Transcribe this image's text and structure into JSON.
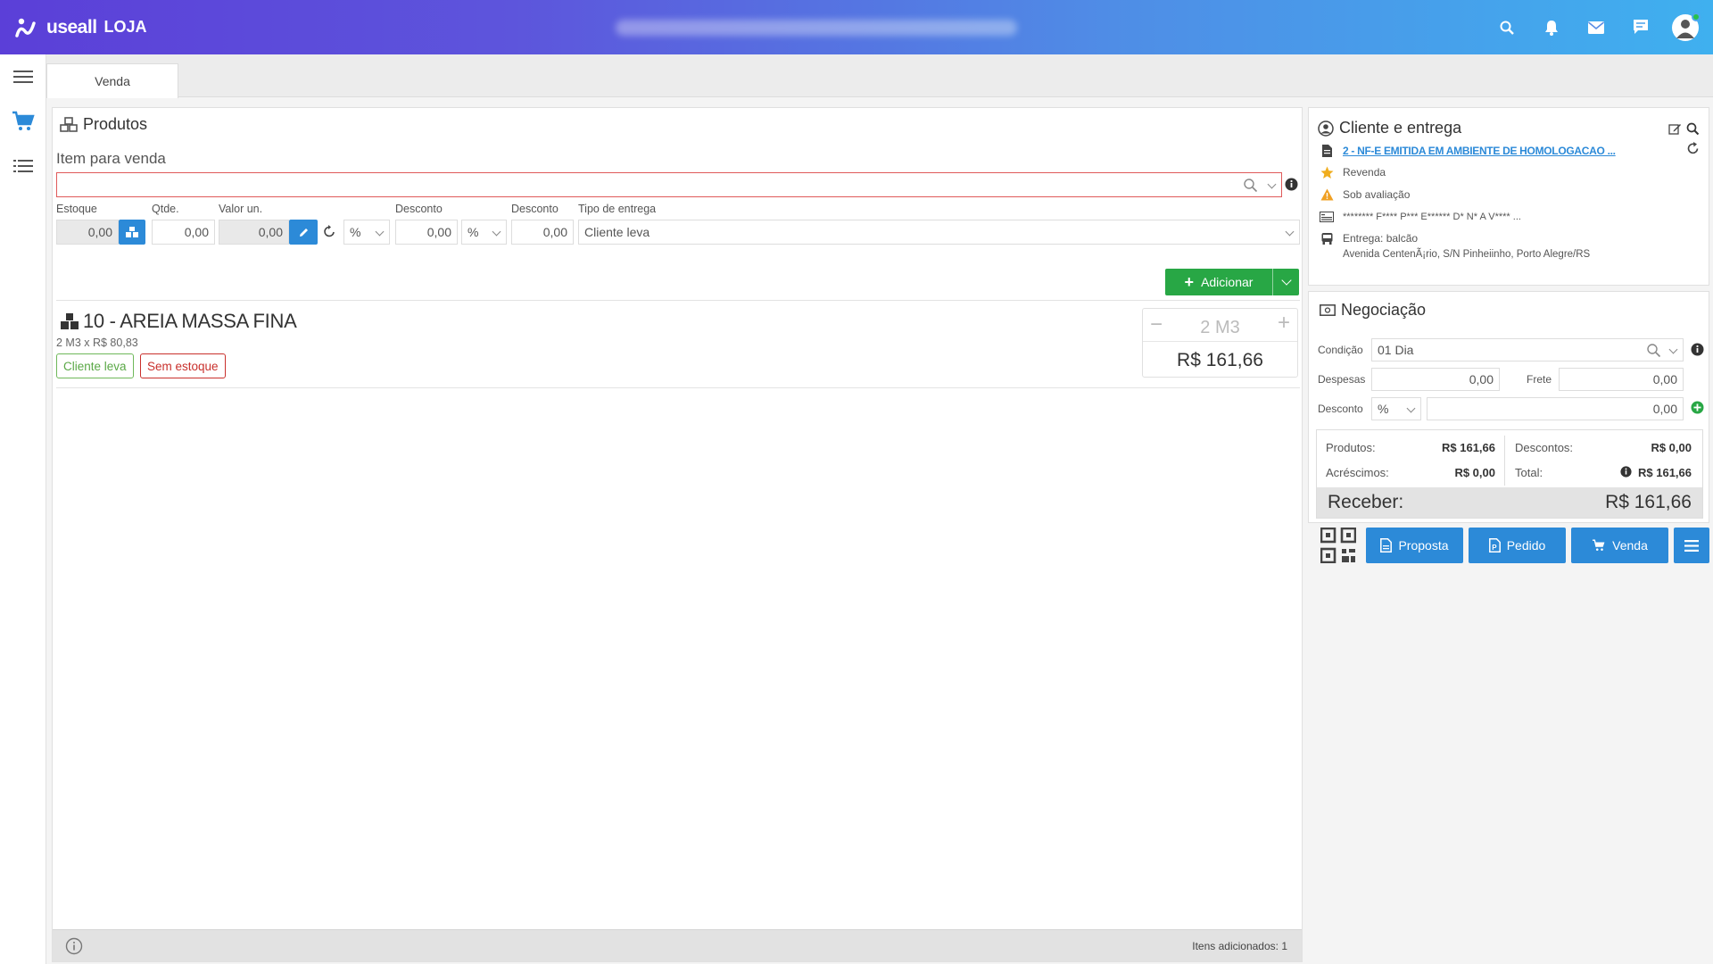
{
  "app": {
    "logo": "useall",
    "module": "LOJA"
  },
  "colors": {
    "primary_blue": "#2c8ad8",
    "green": "#28a745",
    "red": "#d9534f",
    "header_start": "#5b3fd8",
    "header_end": "#3fb0ef"
  },
  "header": {
    "icons": [
      "search-icon",
      "bell-icon",
      "mail-icon",
      "chat-icon",
      "avatar"
    ]
  },
  "sidebar": {
    "items": [
      "menu-icon",
      "cart-icon",
      "list-icon"
    ]
  },
  "tabs": [
    {
      "label": "Venda"
    }
  ],
  "produtos": {
    "title": "Produtos",
    "item_label": "Item para venda",
    "fields": {
      "estoque_label": "Estoque",
      "estoque_value": "0,00",
      "qtde_label": "Qtde.",
      "qtde_value": "0,00",
      "valor_label": "Valor un.",
      "valor_value": "0,00",
      "desconto_label": "Desconto",
      "desconto_type": "%",
      "desconto_value": "0,00",
      "desconto2_label": "Desconto",
      "desconto2_type": "%",
      "desconto2_value": "0,00",
      "entrega_label": "Tipo de entrega",
      "entrega_value": "Cliente leva"
    },
    "add_button": "Adicionar",
    "item": {
      "title": "10 - AREIA MASSA FINA",
      "subtitle": "2 M3 x R$ 80,83",
      "tags": [
        "Cliente leva",
        "Sem estoque"
      ],
      "quantity": "2 M3",
      "total": "R$ 161,66"
    },
    "footer": {
      "count_text": "Itens adicionados: 1"
    }
  },
  "cliente": {
    "title": "Cliente e entrega",
    "document": "2 - NF-E EMITIDA EM AMBIENTE DE HOMOLOGACAO ...",
    "category": "Revenda",
    "status": "Sob avaliação",
    "address_masked": "******** F**** P*** E****** D* N* A V**** ...",
    "entrega": "Entrega: balcão",
    "address": "Avenida CentenÃ¡rio, S/N Pinheiinho, Porto Alegre/RS"
  },
  "negociacao": {
    "title": "Negociação",
    "condicao_label": "Condição",
    "condicao_value": "01 Dia",
    "despesas_label": "Despesas",
    "despesas_value": "0,00",
    "frete_label": "Frete",
    "frete_value": "0,00",
    "desconto_label": "Desconto",
    "desconto_type": "%",
    "desconto_value": "0,00",
    "totals": {
      "produtos_label": "Produtos:",
      "produtos_value": "R$ 161,66",
      "descontos_label": "Descontos:",
      "descontos_value": "R$ 0,00",
      "acrescimos_label": "Acréscimos:",
      "acrescimos_value": "R$ 0,00",
      "total_label": "Total:",
      "total_value": "R$ 161,66",
      "receber_label": "Receber:",
      "receber_value": "R$ 161,66"
    }
  },
  "actions": {
    "proposta": "Proposta",
    "pedido": "Pedido",
    "venda": "Venda"
  }
}
